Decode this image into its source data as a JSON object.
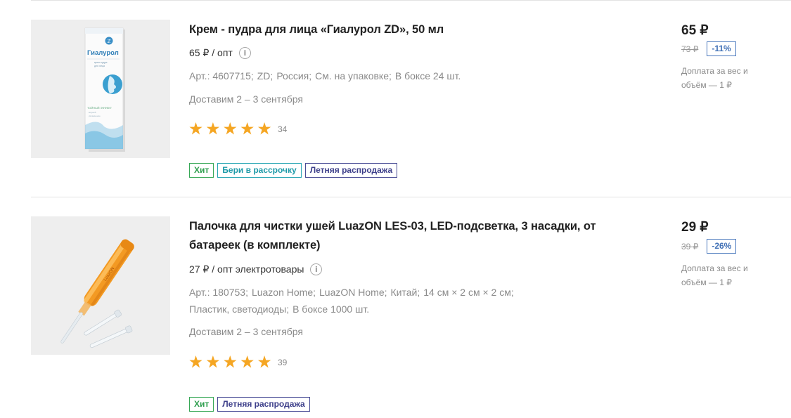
{
  "products": [
    {
      "title": "Крем - пудра для лица «Гиалурол ZD», 50 мл",
      "opt_price": "65 ₽ / опт",
      "specs": {
        "article": "Арт.: 4607715;",
        "brand": "ZD",
        "country": "Россия;",
        "size": "См. на упаковке;",
        "box": "В боксе 24 шт."
      },
      "delivery": "Доставим 2 – 3 сентября",
      "rating": 5,
      "rating_count": "34",
      "badges": [
        {
          "label": "Хит",
          "color": "#37a856"
        },
        {
          "label": "Бери в рассрочку",
          "color": "#27a5b3"
        },
        {
          "label": "Летняя распродажа",
          "color": "#4a4d96"
        }
      ],
      "price": "65 ₽",
      "old_price": "73 ₽",
      "discount": "-11%",
      "surcharge": "Доплата за вес и объём — 1 ₽",
      "image_icon": "cream-tube-image",
      "package_label": "Гиалурол"
    },
    {
      "title": "Палочка для чистки ушей LuazON LES-03, LED-подсветка, 3 насадки, от батареек (в комплекте)",
      "opt_price": "27 ₽ / опт электротовары",
      "specs": {
        "article": "Арт.: 180753;",
        "brand": "Luazon Home;",
        "brand2": "LuazON Home;",
        "country": "Китай;",
        "size": "14 см × 2 см × 2 см;",
        "material": "Пластик, светодиоды;",
        "box": "В боксе 1000 шт."
      },
      "delivery": "Доставим 2 – 3 сентября",
      "rating": 5,
      "rating_count": "39",
      "badges": [
        {
          "label": "Хит",
          "color": "#37a856"
        },
        {
          "label": "Летняя распродажа",
          "color": "#4a4d96"
        }
      ],
      "price": "29 ₽",
      "old_price": "39 ₽",
      "discount": "-26%",
      "surcharge": "Доплата за вес и объём — 1 ₽",
      "image_icon": "ear-cleaner-image"
    }
  ],
  "colors": {
    "link": "#3f6fb5",
    "star": "#f5a623",
    "muted_text": "#8a8a8a"
  }
}
